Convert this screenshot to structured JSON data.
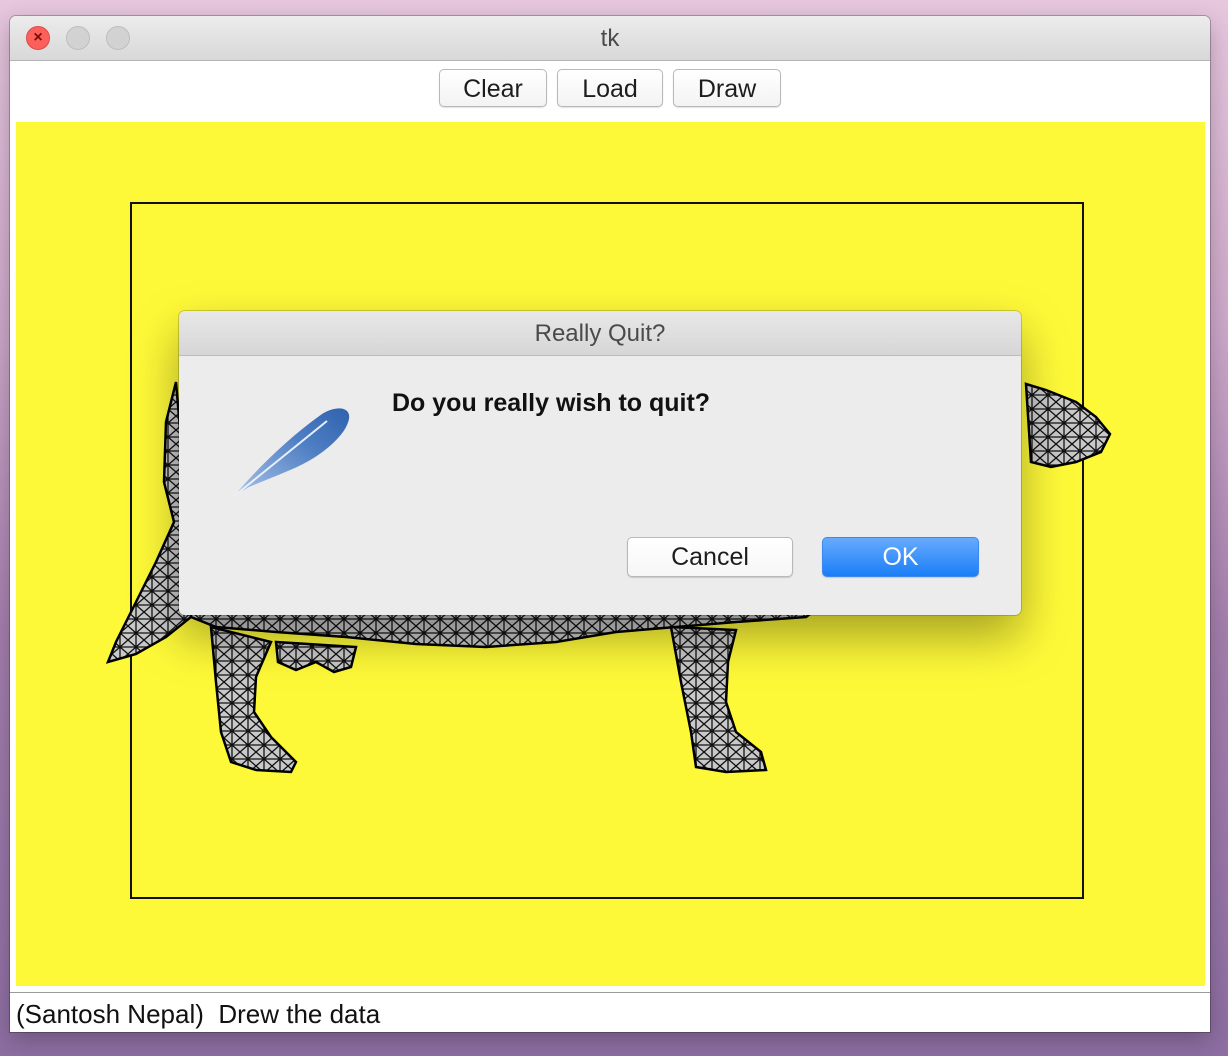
{
  "window": {
    "title": "tk"
  },
  "toolbar": {
    "clear_label": "Clear",
    "load_label": "Load",
    "draw_label": "Draw"
  },
  "canvas": {
    "background": "#fef938",
    "frame_color": "#111111"
  },
  "status": {
    "text": "(Santosh Nepal)  Drew the data"
  },
  "dialog": {
    "title": "Really Quit?",
    "message": "Do you really wish to quit?",
    "cancel_label": "Cancel",
    "ok_label": "OK",
    "icon": "feather-icon",
    "ok_color": "#1a7ef7"
  }
}
